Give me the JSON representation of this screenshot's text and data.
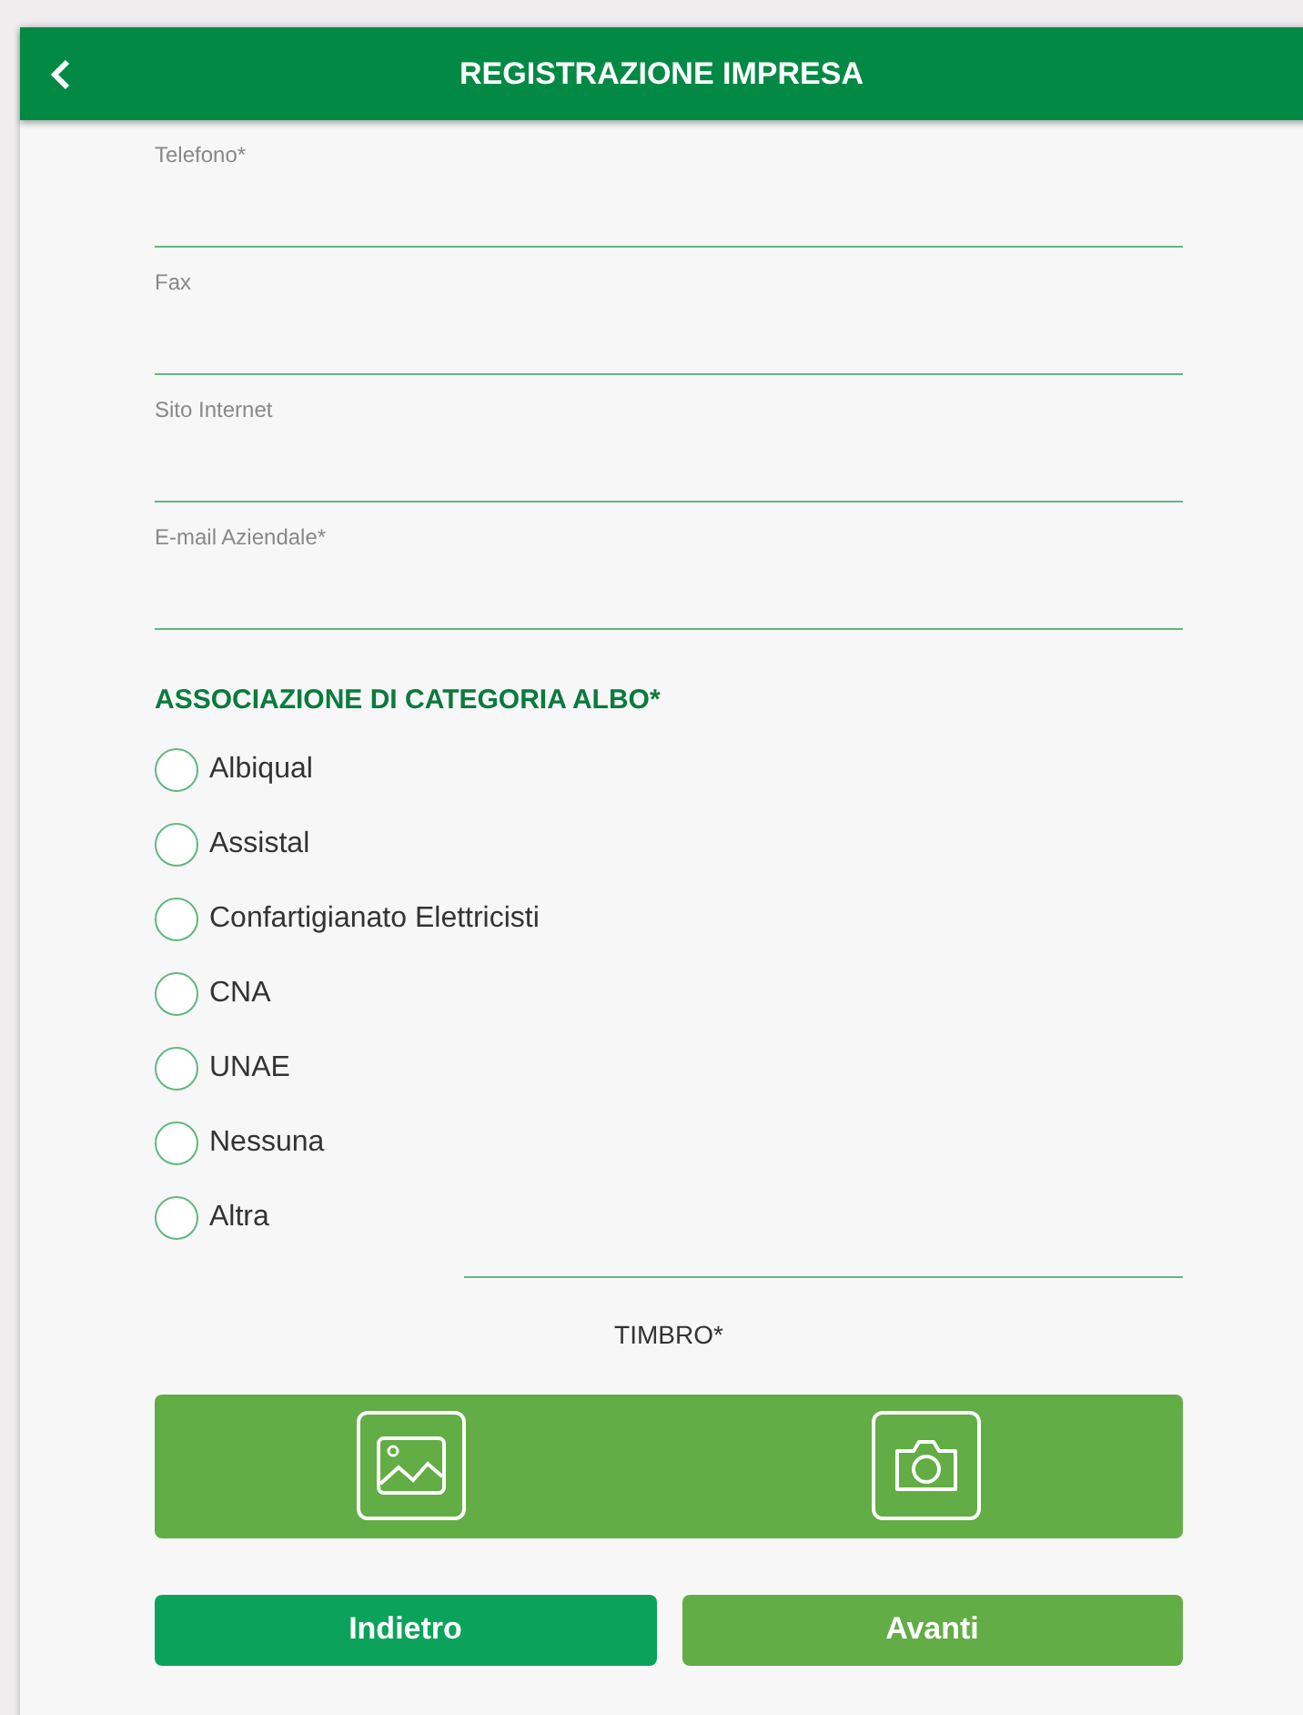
{
  "header": {
    "title": "REGISTRAZIONE IMPRESA"
  },
  "fields": [
    {
      "label": "Telefono*"
    },
    {
      "label": "Fax"
    },
    {
      "label": "Sito Internet"
    },
    {
      "label": "E-mail Aziendale*"
    }
  ],
  "association": {
    "heading": "ASSOCIAZIONE DI CATEGORIA ALBO*",
    "options": [
      {
        "label": "Albiqual",
        "selected": false
      },
      {
        "label": "Assistal",
        "selected": false
      },
      {
        "label": "Confartigianato Elettricisti",
        "selected": false
      },
      {
        "label": "CNA",
        "selected": false
      },
      {
        "label": "UNAE",
        "selected": false
      },
      {
        "label": "Nessuna",
        "selected": false
      },
      {
        "label": "Altra",
        "selected": false,
        "kind": "other"
      }
    ]
  },
  "stamp": {
    "label": "TIMBRO*"
  },
  "buttons": [
    {
      "label": "Indietro",
      "kind": "back"
    },
    {
      "label": "Avanti",
      "kind": "next"
    }
  ]
}
